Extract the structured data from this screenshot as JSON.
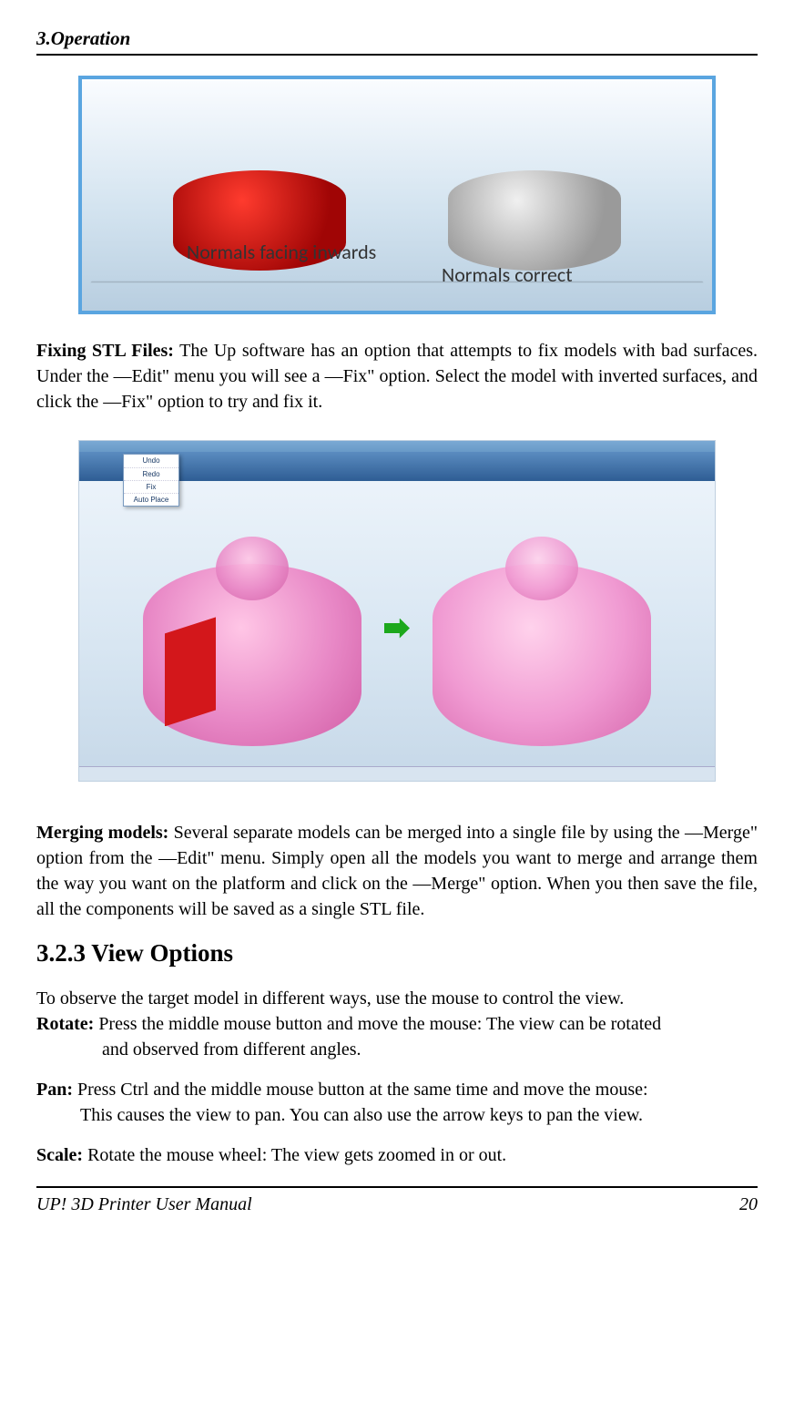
{
  "page": {
    "header_section": "3.Operation",
    "footer_left": "UP!  3D  Printer  User  Manual",
    "footer_right": "20"
  },
  "fig1": {
    "label_left": "Normals facing inwards",
    "label_right": "Normals correct"
  },
  "text": {
    "fix_stl_bold": "Fixing STL Files:",
    "fix_stl_body": " The Up software has an option that attempts to fix models with bad surfaces. Under the ―Edit\" menu you will see a ―Fix\" option. Select the model with inverted surfaces, and click the ―Fix\" option to try and fix it.",
    "merge_bold": "Merging models:",
    "merge_body": " Several separate models can be merged into a single file by using the ―Merge\" option from the ―Edit\" menu. Simply open all the models you want to merge and arrange them the way you want on the platform and click on the ―Merge\" option. When you then save the file, all the components will be saved as a single STL file.",
    "heading_view": "3.2.3 View Options",
    "view_intro": "To observe the target model in different ways, use the mouse to control the view.",
    "rotate_bold": "Rotate:",
    "rotate_body_line1": " Press the middle mouse button and move the mouse: The view can be rotated",
    "rotate_body_line2": "and observed from different angles.",
    "pan_bold": "Pan:",
    "pan_body_line1": " Press Ctrl and the middle mouse button at the same time and move the mouse:",
    "pan_body_line2": "This causes the view to pan. You can also use the arrow keys to pan the view.",
    "scale_bold": "Scale:",
    "scale_body": " Rotate the mouse wheel: The view gets zoomed in or out."
  },
  "edit_menu": {
    "items": [
      "Undo",
      "Redo",
      "Fix",
      "Auto Place"
    ]
  }
}
